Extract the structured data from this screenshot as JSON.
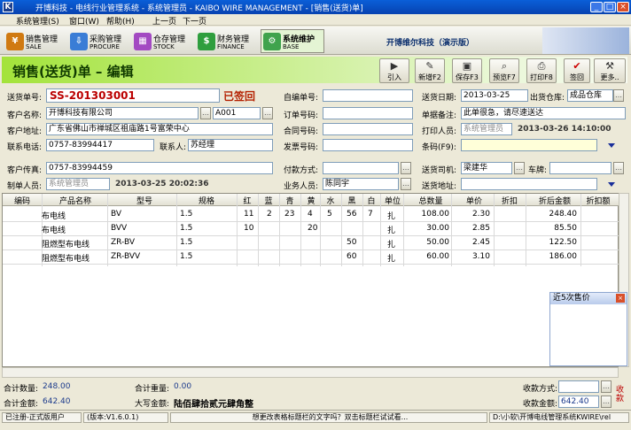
{
  "window": {
    "title": "开博科技 - 电线行业管理系统 - 系统管理员 - KAIBO WIRE MANAGEMENT - [销售(送货)单]",
    "icon": "K"
  },
  "menu": [
    "系统管理(S)",
    "窗口(W)",
    "帮助(H)",
    "上一页",
    "下一页"
  ],
  "modules": [
    {
      "cn": "销售管理",
      "en": "SALE",
      "icon": "cart-icon",
      "color": "#d07a12"
    },
    {
      "cn": "采购管理",
      "en": "PROCURE",
      "icon": "procure-icon",
      "color": "#3a7dd6"
    },
    {
      "cn": "仓存管理",
      "en": "STOCK",
      "icon": "warehouse-icon",
      "color": "#a34ac2"
    },
    {
      "cn": "财务管理",
      "en": "FINANCE",
      "icon": "money-icon",
      "color": "#2f9e3e"
    },
    {
      "cn": "系统维护",
      "en": "BASE",
      "icon": "base-icon",
      "color": "#3fa34d"
    }
  ],
  "company": "开博维尔科技（演示版）",
  "header": {
    "title": "销售(送货)单 – 编辑"
  },
  "toolbar": [
    {
      "label": "引入",
      "icon": "import-icon",
      "glyph": "▶"
    },
    {
      "label": "新增F2",
      "icon": "new-icon",
      "glyph": "✎"
    },
    {
      "label": "保存F3",
      "icon": "save-icon",
      "glyph": "▣"
    },
    {
      "label": "预览F7",
      "icon": "preview-icon",
      "glyph": "⌕"
    },
    {
      "label": "打印F8",
      "icon": "print-icon",
      "glyph": "⎙"
    },
    {
      "label": "签回",
      "icon": "check-icon",
      "glyph": "✔"
    },
    {
      "label": "更多..",
      "icon": "more-icon",
      "glyph": "⚒"
    }
  ],
  "form": {
    "order_no_label": "送货单号:",
    "order_no": "SS-201303001",
    "status": "已签回",
    "self_no_label": "自编单号:",
    "self_no": "",
    "delivery_date_label": "送货日期:",
    "delivery_date": "2013-03-25",
    "warehouse_label": "出货仓库:",
    "warehouse": "成品仓库",
    "customer_label": "客户名称:",
    "customer": "开博科技有限公司",
    "customer_code": "A001",
    "order_label": "订单号码:",
    "order": "",
    "remark_label": "单据备注:",
    "remark": "此单很急，请尽速送达",
    "address_label": "客户地址:",
    "address": "广东省佛山市禅城区祖庙路1号富荣中心",
    "contract_label": "合同号码:",
    "contract": "",
    "printer_label": "打印人员:",
    "printer": "系统管理员",
    "print_time": "2013-03-26 14:10:00",
    "phone_label": "联系电话:",
    "phone": "0757-83994417",
    "contact_label": "联系人:",
    "contact": "苏经理",
    "invoice_label": "发票号码:",
    "invoice": "",
    "barcode_label": "条码(F9):",
    "barcode": "",
    "fax_label": "客户传真:",
    "fax": "0757-83994459",
    "payment_label": "付款方式:",
    "payment": "",
    "driver_label": "送货司机:",
    "driver": "梁建华",
    "plate_label": "车牌:",
    "plate": "",
    "maker_label": "制单人员:",
    "maker": "系统管理员",
    "make_time": "2013-03-25 20:02:36",
    "salesman_label": "业务人员:",
    "salesman": "陈同宇",
    "ship_addr_label": "送货地址:",
    "ship_addr": ""
  },
  "grid": {
    "columns": [
      "编码",
      "产品名称",
      "型号",
      "规格",
      "红",
      "蓝",
      "青",
      "黄",
      "水",
      "黑",
      "白",
      "单位",
      "总数量",
      "单价",
      "折扣",
      "折后金额",
      "折扣额"
    ],
    "rows": [
      {
        "code": "",
        "name": "布电线",
        "model": "BV",
        "spec": "1.5",
        "red": "11",
        "blue": "2",
        "cyan": "23",
        "yellow": "4",
        "water": "5",
        "black": "56",
        "white": "7",
        "unit": "扎",
        "qty": "108.00",
        "price": "2.30",
        "discount": "",
        "amount": "248.40",
        "disc_amt": ""
      },
      {
        "code": "",
        "name": "布电线",
        "model": "BVV",
        "spec": "1.5",
        "red": "10",
        "blue": "",
        "cyan": "",
        "yellow": "20",
        "water": "",
        "black": "",
        "white": "",
        "unit": "扎",
        "qty": "30.00",
        "price": "2.85",
        "discount": "",
        "amount": "85.50",
        "disc_amt": ""
      },
      {
        "code": "",
        "name": "阻燃型布电线",
        "model": "ZR-BV",
        "spec": "1.5",
        "red": "",
        "blue": "",
        "cyan": "",
        "yellow": "",
        "water": "",
        "black": "50",
        "white": "",
        "unit": "扎",
        "qty": "50.00",
        "price": "2.45",
        "discount": "",
        "amount": "122.50",
        "disc_amt": ""
      },
      {
        "code": "",
        "name": "阻燃型布电线",
        "model": "ZR-BVV",
        "spec": "1.5",
        "red": "",
        "blue": "",
        "cyan": "",
        "yellow": "",
        "water": "",
        "black": "60",
        "white": "",
        "unit": "扎",
        "qty": "60.00",
        "price": "3.10",
        "discount": "",
        "amount": "186.00",
        "disc_amt": ""
      }
    ]
  },
  "side_panel": {
    "title": "近5次售价"
  },
  "footer": {
    "total_qty_label": "合计数量:",
    "total_qty": "248.00",
    "total_weight_label": "合计重量:",
    "total_weight": "0.00",
    "total_amount_label": "合计金额:",
    "total_amount": "642.40",
    "upper_label": "大写金额:",
    "upper": "陆佰肆拾贰元肆角整",
    "receive_method_label": "收款方式:",
    "receive_method": "",
    "received_label": "收款金额:",
    "received": "642.40",
    "receive_btn": "收款"
  },
  "statusbar": {
    "user": "已注册-正式版用户",
    "version": "(版本:V1.6.0.1)",
    "hint": "想更改表格标题栏的文字吗？双击标题栏试试看...",
    "path": "D:\\小软\\开博电线管理系统KWIRE\\rel"
  }
}
